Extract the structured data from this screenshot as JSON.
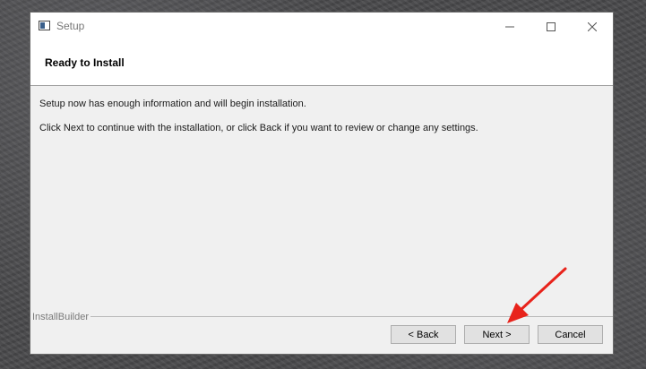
{
  "window": {
    "title": "Setup",
    "icon": "installer-app-icon",
    "controls": {
      "minimize": "minimize-icon",
      "maximize": "maximize-icon",
      "close": "close-icon"
    }
  },
  "header": {
    "title": "Ready to Install"
  },
  "content": {
    "line1": "Setup now has enough information and will begin installation.",
    "line2": "Click Next to continue with the installation, or click Back if you want to review or change any settings."
  },
  "footer": {
    "brand": "InstallBuilder",
    "buttons": {
      "back": "< Back",
      "next": "Next >",
      "cancel": "Cancel"
    }
  },
  "annotation": {
    "arrow_color": "#e8231b",
    "points_to": "next-button"
  },
  "colors": {
    "dialog_bg": "#f0f0f0",
    "header_bg": "#ffffff",
    "button_bg": "#e1e1e1"
  }
}
